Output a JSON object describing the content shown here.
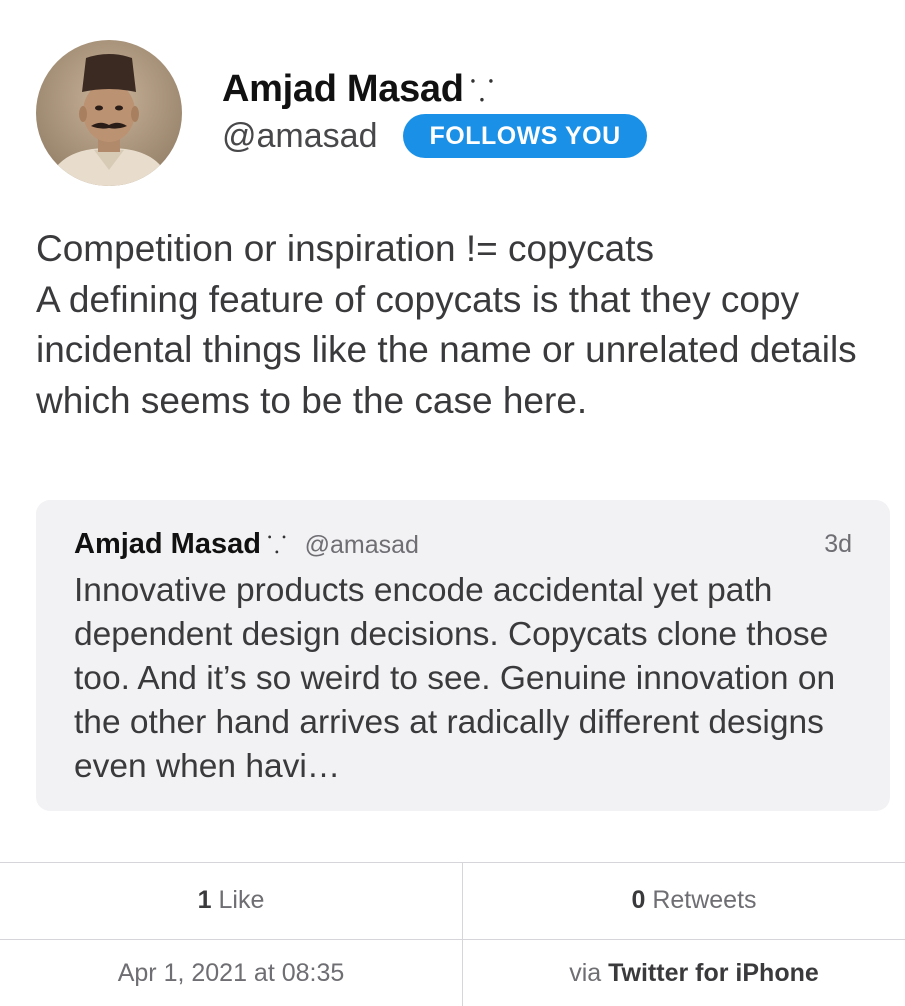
{
  "header": {
    "display_name": "Amjad Masad",
    "name_glyph": "⸪",
    "handle": "@amasad",
    "follows_badge": "FOLLOWS YOU"
  },
  "tweet": {
    "text": "Competition or inspiration != copycats\nA defining feature of copycats is that they copy incidental things like the name or unrelated details which seems to be the case here."
  },
  "quoted_tweet": {
    "display_name": "Amjad Masad",
    "name_glyph": "⸪",
    "handle": "@amasad",
    "time": "3d",
    "text": "Innovative products encode accidental yet path dependent design decisions. Copycats clone those too. And it’s so weird to see. Genuine innovation on the other hand arrives at radically different designs even when havi…"
  },
  "stats": {
    "likes_count": "1",
    "likes_label": "Like",
    "retweets_count": "0",
    "retweets_label": "Retweets"
  },
  "meta": {
    "timestamp": "Apr 1, 2021 at 08:35",
    "via_prefix": "via",
    "client": "Twitter for iPhone"
  },
  "icons": {
    "avatar": "sepia-portrait-photo",
    "name_glyph": "dots-pattern-icon"
  },
  "colors": {
    "badge": "#1a91e6",
    "quote_background": "#f2f2f4",
    "divider": "#d6d6da"
  }
}
